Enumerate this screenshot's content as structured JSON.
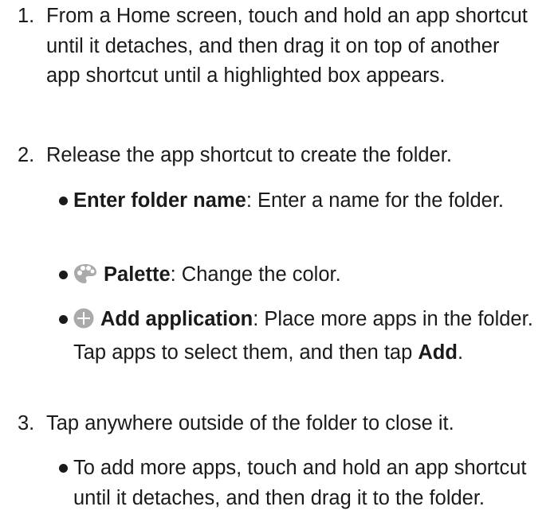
{
  "steps": [
    {
      "number": "1.",
      "text": "From a Home screen, touch and hold an app shortcut until it detaches, and then drag it on top of another app shortcut until a highlighted box appears."
    },
    {
      "number": "2.",
      "text": "Release the app shortcut to create the folder.",
      "bullets": [
        {
          "label": "Enter folder name",
          "text": ": Enter a name for the folder."
        },
        {
          "icon": "palette-icon",
          "label": "Palette",
          "text": ": Change the color."
        },
        {
          "icon": "add-circle-icon",
          "label": "Add application",
          "text": ": Place more apps in the folder. Tap apps to select them, and then tap ",
          "label2": "Add",
          "text2": "."
        }
      ]
    },
    {
      "number": "3.",
      "text": "Tap anywhere outside of the folder to close it.",
      "bullets": [
        {
          "text": "To add more apps, touch and hold an app shortcut until it detaches, and then drag it to the folder."
        }
      ]
    }
  ],
  "colors": {
    "text": "#1a1a1a",
    "icon": "#aaaaaa"
  }
}
